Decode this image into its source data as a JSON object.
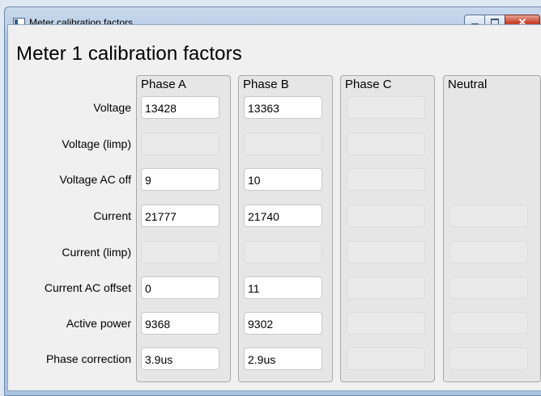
{
  "window": {
    "title": "Meter calibration factors"
  },
  "page": {
    "title": "Meter 1 calibration factors"
  },
  "columns": [
    "Phase A",
    "Phase B",
    "Phase C",
    "Neutral"
  ],
  "rows": [
    {
      "label": "Voltage",
      "values": [
        "13428",
        "13363",
        "",
        null
      ]
    },
    {
      "label": "Voltage (limp)",
      "values": [
        "",
        "",
        "",
        null
      ]
    },
    {
      "label": "Voltage AC off",
      "values": [
        "9",
        "10",
        "",
        null
      ]
    },
    {
      "label": "Current",
      "values": [
        "21777",
        "21740",
        "",
        ""
      ]
    },
    {
      "label": "Current (limp)",
      "values": [
        "",
        "",
        "",
        ""
      ]
    },
    {
      "label": "Current AC offset",
      "values": [
        "0",
        "11",
        "",
        ""
      ]
    },
    {
      "label": "Active power",
      "values": [
        "9368",
        "9302",
        "",
        ""
      ]
    },
    {
      "label": "Phase correction",
      "values": [
        "3.9us",
        "2.9us",
        "",
        ""
      ]
    }
  ],
  "icons": {
    "window": "app-window-icon",
    "minimize": "minimize-icon",
    "maximize": "maximize-icon",
    "close": "close-icon"
  }
}
